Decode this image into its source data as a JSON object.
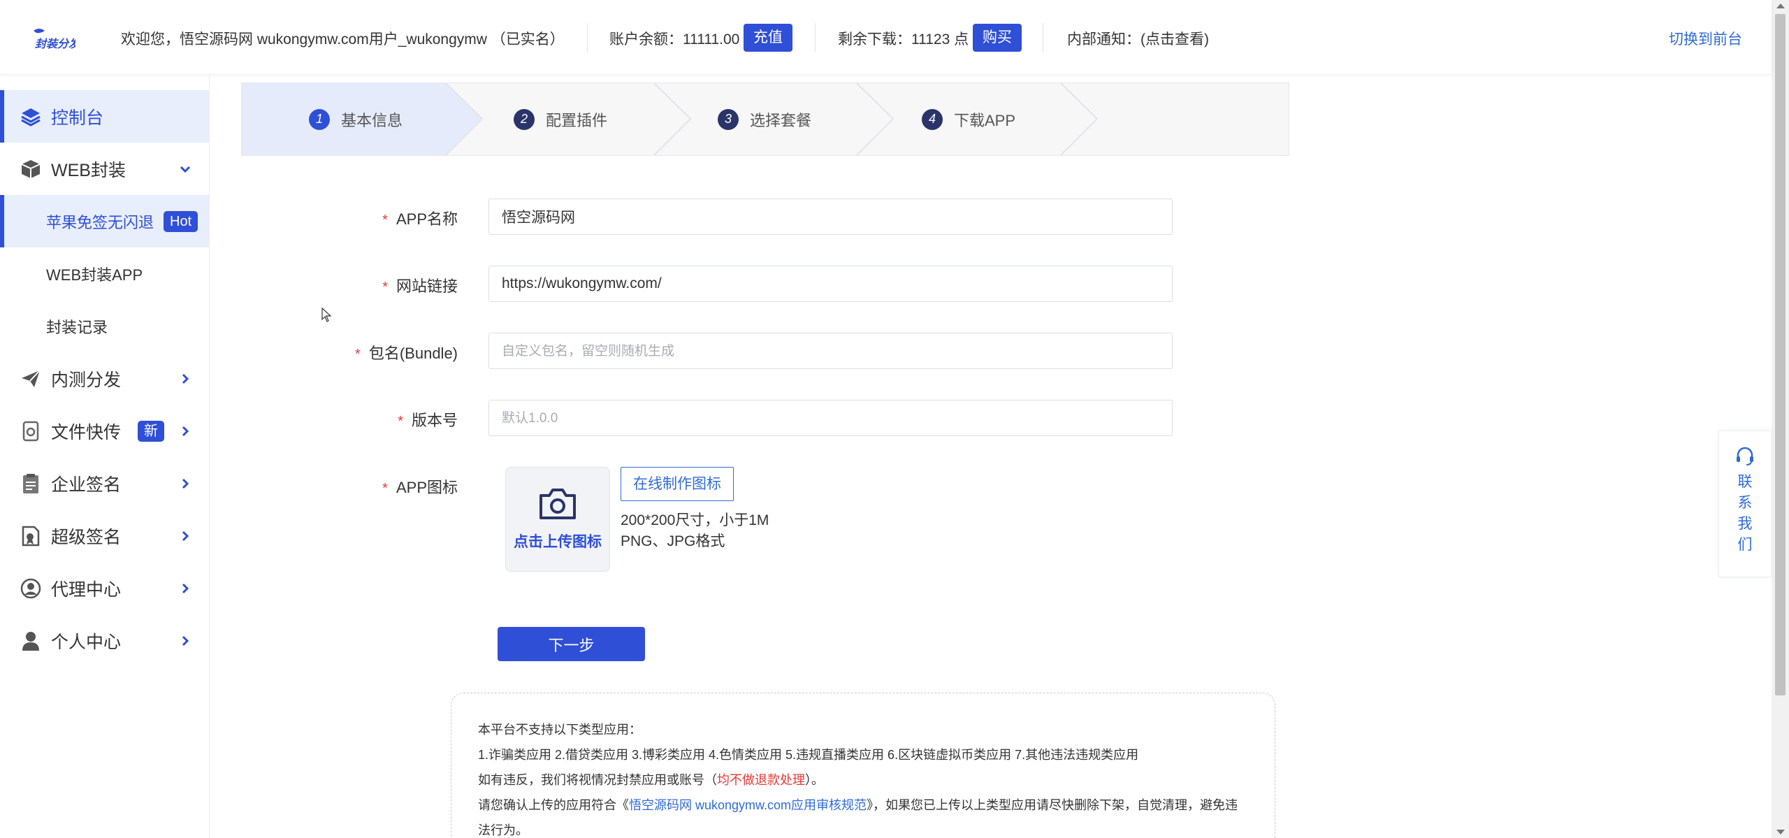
{
  "header": {
    "welcome": "欢迎您，悟空源码网 wukongymw.com用户_wukongymw （已实名）",
    "balance_label": "账户余额：11111.00",
    "recharge_label": "充值",
    "downloads_label": "剩余下载：11123 点",
    "buy_label": "购买",
    "notice_label": "内部通知：(点击查看)",
    "switch_label": "切换到前台"
  },
  "sidebar": {
    "items": [
      {
        "label": "控制台",
        "icon": "layers-icon"
      },
      {
        "label": "WEB封装",
        "icon": "box-icon"
      },
      {
        "label": "内测分发",
        "icon": "paper-plane-icon"
      },
      {
        "label": "文件快传",
        "icon": "file-transfer-icon",
        "badge": "新"
      },
      {
        "label": "企业签名",
        "icon": "clipboard-icon"
      },
      {
        "label": "超级签名",
        "icon": "certificate-icon"
      },
      {
        "label": "代理中心",
        "icon": "agent-icon"
      },
      {
        "label": "个人中心",
        "icon": "user-icon"
      }
    ],
    "sub_items": [
      {
        "label": "苹果免签无闪退",
        "badge": "Hot"
      },
      {
        "label": "WEB封装APP"
      },
      {
        "label": "封装记录"
      }
    ]
  },
  "steps": [
    {
      "num": "1",
      "label": "基本信息"
    },
    {
      "num": "2",
      "label": "配置插件"
    },
    {
      "num": "3",
      "label": "选择套餐"
    },
    {
      "num": "4",
      "label": "下载APP"
    }
  ],
  "form": {
    "app_name_label": "APP名称",
    "app_name_value": "悟空源码网",
    "site_url_label": "网站链接",
    "site_url_value": "https://wukongymw.com/",
    "bundle_label": "包名(Bundle)",
    "bundle_placeholder": "自定义包名，留空则随机生成",
    "version_label": "版本号",
    "version_placeholder": "默认1.0.0",
    "icon_label": "APP图标",
    "upload_label": "点击上传图标",
    "make_icon_label": "在线制作图标",
    "hint_size": "200*200尺寸，小于1M",
    "hint_format": "PNG、JPG格式",
    "next_label": "下一步",
    "required_mark": "*"
  },
  "notice": {
    "line1": "本平台不支持以下类型应用：",
    "line2": "1.诈骗类应用 2.借贷类应用 3.博彩类应用 4.色情类应用 5.违规直播类应用 6.区块链虚拟币类应用 7.其他违法违规类应用",
    "line3_pre": "如有违反，我们将视情况封禁应用或账号（",
    "line3_red": "均不做退款处理",
    "line3_post": "）。",
    "line4_pre": "请您确认上传的应用符合《",
    "line4_link": "悟空源码网 wukongymw.com应用审核规范",
    "line4_post": "》，如果您已上传以上类型应用请尽快删除下架，自觉清理，避免违法行为。"
  },
  "contact": {
    "label": "联系我们",
    "icon": "headset-icon"
  },
  "colors": {
    "accent": "#2f4fd6",
    "link": "#2f6bd6",
    "danger": "#e53935",
    "active_bg": "#e8eefc"
  }
}
